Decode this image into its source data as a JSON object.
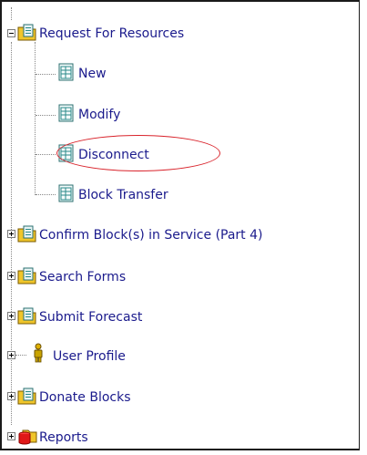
{
  "tree": {
    "root": {
      "label": "Request For Resources",
      "expanded": true,
      "children": [
        {
          "label": "New"
        },
        {
          "label": "Modify"
        },
        {
          "label": "Disconnect",
          "highlighted": true
        },
        {
          "label": "Block Transfer"
        }
      ]
    },
    "items": [
      {
        "label": "Confirm Block(s) in Service (Part 4)",
        "icon": "folder-form-icon"
      },
      {
        "label": "Search Forms",
        "icon": "folder-form-icon"
      },
      {
        "label": "Submit Forecast",
        "icon": "folder-form-icon"
      },
      {
        "label": "User Profile",
        "icon": "user-icon"
      },
      {
        "label": "Donate Blocks",
        "icon": "folder-form-icon"
      },
      {
        "label": "Reports",
        "icon": "reports-icon"
      }
    ]
  },
  "colors": {
    "link_text": "#1a1a8c",
    "highlight_circle": "#d9232b",
    "folder_yellow": "#f0c52a",
    "doc_teal": "#2a8a8a"
  }
}
